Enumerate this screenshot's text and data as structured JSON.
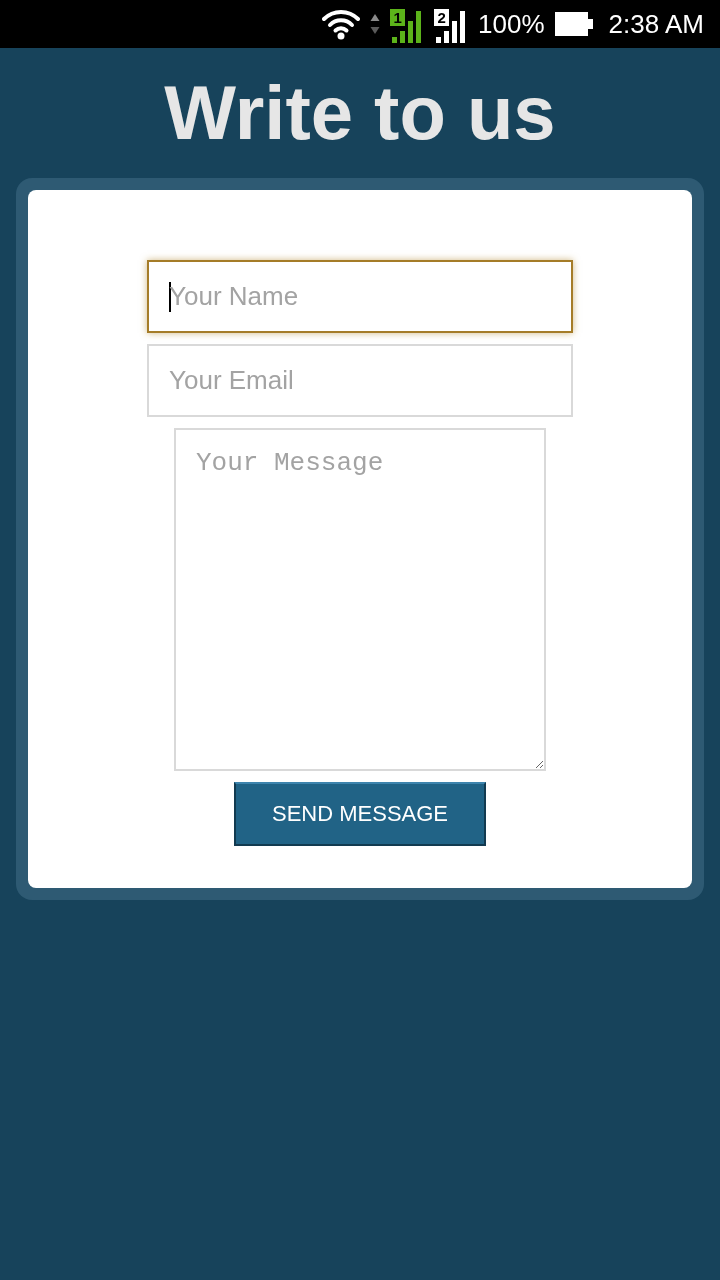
{
  "status_bar": {
    "sims": [
      {
        "label": "1",
        "color": "#5cb31a"
      },
      {
        "label": "2",
        "color": "#ffffff"
      }
    ],
    "battery": "100%",
    "time": "2:38 AM"
  },
  "title": "Write to us",
  "form": {
    "fields": [
      {
        "kind": "text",
        "placeholder": "Your Name",
        "focused": true
      },
      {
        "kind": "text",
        "placeholder": "Your Email",
        "focused": false
      },
      {
        "kind": "textarea",
        "placeholder": "Your Message",
        "focused": false
      }
    ],
    "submit": "SEND MESSAGE"
  }
}
